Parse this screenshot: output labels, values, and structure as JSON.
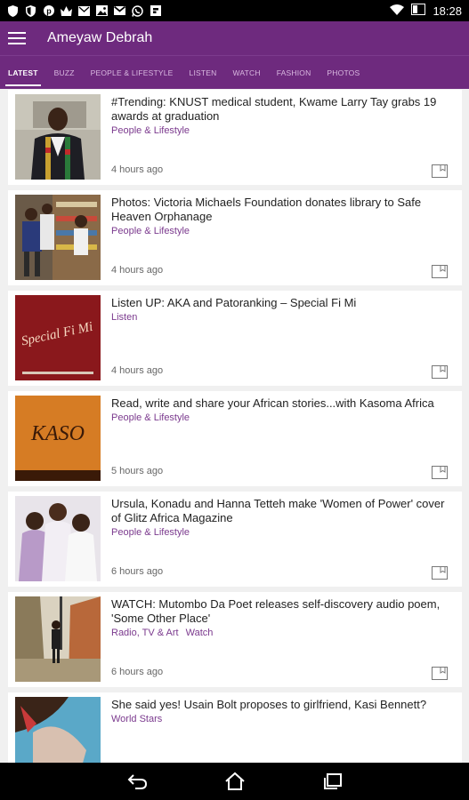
{
  "status_bar": {
    "time": "18:28",
    "icons": [
      "shield-icon",
      "shield-icon",
      "pinterest-icon",
      "crown-icon",
      "mail-icon",
      "image-icon",
      "gmail-icon",
      "whatsapp-icon",
      "flipboard-icon",
      "wifi-icon",
      "battery-icon"
    ]
  },
  "app_bar": {
    "title": "Ameyaw Debrah",
    "menu_icon": "hamburger-menu-icon"
  },
  "tabs": [
    {
      "label": "LATEST",
      "active": true
    },
    {
      "label": "BUZZ"
    },
    {
      "label": "PEOPLE & LIFESTYLE"
    },
    {
      "label": "LISTEN"
    },
    {
      "label": "WATCH"
    },
    {
      "label": "FASHION"
    },
    {
      "label": "PHOTOS"
    }
  ],
  "articles": [
    {
      "headline": "#Trending: KNUST medical student, Kwame Larry Tay grabs 19 awards at graduation",
      "categories": [
        "People & Lifestyle"
      ],
      "time": "4 hours ago"
    },
    {
      "headline": "Photos: Victoria Michaels Foundation donates library to Safe Heaven Orphanage",
      "categories": [
        "People & Lifestyle"
      ],
      "time": "4 hours ago"
    },
    {
      "headline": "Listen UP: AKA and Patoranking – Special Fi Mi",
      "categories": [
        "Listen"
      ],
      "time": "4 hours ago",
      "thumb_text": "Special Fi Mi"
    },
    {
      "headline": "Read, write and share your African stories...with Kasoma Africa",
      "categories": [
        "People & Lifestyle"
      ],
      "time": "5 hours ago",
      "thumb_text": "KASO"
    },
    {
      "headline": "Ursula, Konadu and Hanna Tetteh make 'Women of Power' cover of Glitz Africa Magazine",
      "categories": [
        "People & Lifestyle"
      ],
      "time": "6 hours ago"
    },
    {
      "headline": "WATCH: Mutombo Da Poet releases self-discovery audio poem, 'Some Other Place'",
      "categories": [
        "Radio, TV & Art",
        "Watch"
      ],
      "time": "6 hours ago"
    },
    {
      "headline": "She said yes! Usain Bolt proposes to girlfriend, Kasi Bennett?",
      "categories": [
        "World Stars"
      ],
      "time": ""
    }
  ],
  "nav_bar": {
    "icons": [
      "back-icon",
      "home-icon",
      "recent-apps-icon"
    ]
  },
  "colors": {
    "primary": "#6e2a7e",
    "category": "#7b3a8e",
    "background": "#f0f0f0"
  }
}
